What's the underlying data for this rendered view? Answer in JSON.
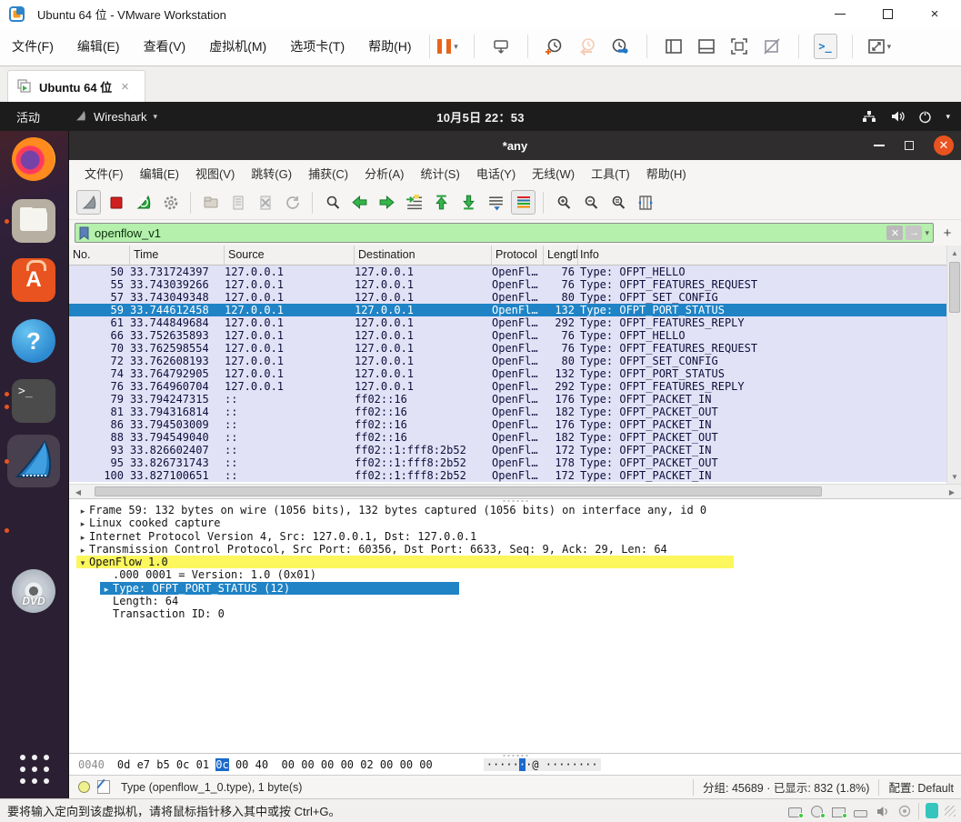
{
  "colors": {
    "selection_blue": "#1f83c5",
    "filter_green": "#b5f0ac",
    "highlight_yellow": "#fbf75d",
    "ubuntu_orange": "#e95420",
    "row_lavender": "#e2e2f6",
    "ws_titlebar": "#2f2d2d",
    "topbar_black": "#1c1c1c"
  },
  "vmware": {
    "title": "Ubuntu 64 位 - VMware Workstation",
    "menu": [
      "文件(F)",
      "编辑(E)",
      "查看(V)",
      "虚拟机(M)",
      "选项卡(T)",
      "帮助(H)"
    ],
    "toolbar_icons": [
      "suspend",
      "send-ctrl-alt-del",
      "take-snapshot",
      "revert-snapshot",
      "manage-snapshots",
      "show-library",
      "show-thumbnail-bar",
      "fullscreen",
      "unity",
      "console-view",
      "fit-guest"
    ],
    "tab_label": "Ubuntu 64 位",
    "status_text": "要将输入定向到该虚拟机，请将鼠标指针移入其中或按 Ctrl+G。",
    "status_icons": [
      "hdd",
      "cdrom",
      "network-adapter",
      "printer",
      "sound",
      "usb",
      "message",
      "resize-grip"
    ]
  },
  "ubuntu": {
    "activities_label": "活动",
    "app_menu_label": "Wireshark",
    "clock": "10月5日 22：53",
    "indicator_icons": [
      "network",
      "volume",
      "power",
      "menu-caret"
    ],
    "dock_items": [
      "firefox",
      "files",
      "ubuntu-software",
      "help",
      "terminal",
      "wireshark",
      "dvd",
      "show-applications"
    ]
  },
  "wireshark": {
    "title": "*any",
    "menu": [
      "文件(F)",
      "编辑(E)",
      "视图(V)",
      "跳转(G)",
      "捕获(C)",
      "分析(A)",
      "统计(S)",
      "电话(Y)",
      "无线(W)",
      "工具(T)",
      "帮助(H)"
    ],
    "toolbar_icons": [
      "start-capture",
      "stop-capture",
      "restart-capture",
      "capture-options",
      "open-file",
      "save-file",
      "close-file",
      "reload",
      "find-packet",
      "go-back",
      "go-forward",
      "go-to-packet",
      "go-first",
      "go-last",
      "auto-scroll",
      "colorize",
      "zoom-in",
      "zoom-out",
      "zoom-reset",
      "resize-columns"
    ],
    "filter": {
      "value": "openflow_v1",
      "add_label": "+"
    },
    "columns": [
      "No.",
      "Time",
      "Source",
      "Destination",
      "Protocol",
      "Length",
      "Info"
    ],
    "packets": [
      {
        "no": "50",
        "time": "33.731724397",
        "src": "127.0.0.1",
        "dst": "127.0.0.1",
        "proto": "OpenFl…",
        "len": "76",
        "info": "Type: OFPT_HELLO"
      },
      {
        "no": "55",
        "time": "33.743039266",
        "src": "127.0.0.1",
        "dst": "127.0.0.1",
        "proto": "OpenFl…",
        "len": "76",
        "info": "Type: OFPT_FEATURES_REQUEST"
      },
      {
        "no": "57",
        "time": "33.743049348",
        "src": "127.0.0.1",
        "dst": "127.0.0.1",
        "proto": "OpenFl…",
        "len": "80",
        "info": "Type: OFPT_SET_CONFIG"
      },
      {
        "no": "59",
        "time": "33.744612458",
        "src": "127.0.0.1",
        "dst": "127.0.0.1",
        "proto": "OpenFl…",
        "len": "132",
        "info": "Type: OFPT_PORT_STATUS",
        "cls": "selected"
      },
      {
        "no": "61",
        "time": "33.744849684",
        "src": "127.0.0.1",
        "dst": "127.0.0.1",
        "proto": "OpenFl…",
        "len": "292",
        "info": "Type: OFPT_FEATURES_REPLY"
      },
      {
        "no": "66",
        "time": "33.752635893",
        "src": "127.0.0.1",
        "dst": "127.0.0.1",
        "proto": "OpenFl…",
        "len": "76",
        "info": "Type: OFPT_HELLO"
      },
      {
        "no": "70",
        "time": "33.762598554",
        "src": "127.0.0.1",
        "dst": "127.0.0.1",
        "proto": "OpenFl…",
        "len": "76",
        "info": "Type: OFPT_FEATURES_REQUEST"
      },
      {
        "no": "72",
        "time": "33.762608193",
        "src": "127.0.0.1",
        "dst": "127.0.0.1",
        "proto": "OpenFl…",
        "len": "80",
        "info": "Type: OFPT_SET_CONFIG"
      },
      {
        "no": "74",
        "time": "33.764792905",
        "src": "127.0.0.1",
        "dst": "127.0.0.1",
        "proto": "OpenFl…",
        "len": "132",
        "info": "Type: OFPT_PORT_STATUS"
      },
      {
        "no": "76",
        "time": "33.764960704",
        "src": "127.0.0.1",
        "dst": "127.0.0.1",
        "proto": "OpenFl…",
        "len": "292",
        "info": "Type: OFPT_FEATURES_REPLY"
      },
      {
        "no": "79",
        "time": "33.794247315",
        "src": "::",
        "dst": "ff02::16",
        "proto": "OpenFl…",
        "len": "176",
        "info": "Type: OFPT_PACKET_IN"
      },
      {
        "no": "81",
        "time": "33.794316814",
        "src": "::",
        "dst": "ff02::16",
        "proto": "OpenFl…",
        "len": "182",
        "info": "Type: OFPT_PACKET_OUT"
      },
      {
        "no": "86",
        "time": "33.794503009",
        "src": "::",
        "dst": "ff02::16",
        "proto": "OpenFl…",
        "len": "176",
        "info": "Type: OFPT_PACKET_IN"
      },
      {
        "no": "88",
        "time": "33.794549040",
        "src": "::",
        "dst": "ff02::16",
        "proto": "OpenFl…",
        "len": "182",
        "info": "Type: OFPT_PACKET_OUT"
      },
      {
        "no": "93",
        "time": "33.826602407",
        "src": "::",
        "dst": "ff02::1:fff8:2b52",
        "proto": "OpenFl…",
        "len": "172",
        "info": "Type: OFPT_PACKET_IN"
      },
      {
        "no": "95",
        "time": "33.826731743",
        "src": "::",
        "dst": "ff02::1:fff8:2b52",
        "proto": "OpenFl…",
        "len": "178",
        "info": "Type: OFPT_PACKET_OUT"
      },
      {
        "no": "100",
        "time": "33.827100651",
        "src": "::",
        "dst": "ff02::1:fff8:2b52",
        "proto": "OpenFl…",
        "len": "172",
        "info": "Type: OFPT_PACKET_IN"
      }
    ],
    "details": [
      {
        "arrow": "▸",
        "text": "Frame 59: 132 bytes on wire (1056 bits), 132 bytes captured (1056 bits) on interface any, id 0"
      },
      {
        "arrow": "▸",
        "text": "Linux cooked capture"
      },
      {
        "arrow": "▸",
        "text": "Internet Protocol Version 4, Src: 127.0.0.1, Dst: 127.0.0.1"
      },
      {
        "arrow": "▸",
        "text": "Transmission Control Protocol, Src Port: 60356, Dst Port: 6633, Seq: 9, Ack: 29, Len: 64"
      },
      {
        "arrow": "▾",
        "text": "OpenFlow 1.0",
        "cls": "hl-yellow"
      },
      {
        "arrow": "",
        "text": ".000 0001 = Version: 1.0 (0x01)",
        "cls": "ind1"
      },
      {
        "arrow": "▸",
        "text": "Type: OFPT_PORT_STATUS (12)",
        "cls": "ind1 hl-blue"
      },
      {
        "arrow": "",
        "text": "Length: 64",
        "cls": "ind1"
      },
      {
        "arrow": "",
        "text": "Transaction ID: 0",
        "cls": "ind1"
      }
    ],
    "hex": {
      "offset": "0040",
      "g1a": "0d e7 b5 0c 01 ",
      "hl": "0c",
      "g1b": " 00 40",
      "g2": "00 00 00 00 02 00 00 00",
      "a1": "·····",
      "ahl": "·",
      "a2": "·@ ",
      "a3": "········"
    },
    "status": {
      "field_info": "Type (openflow_1_0.type), 1 byte(s)",
      "packets_info": "分组: 45689 · 已显示: 832 (1.8%)",
      "profile_label": "配置: Default"
    }
  }
}
